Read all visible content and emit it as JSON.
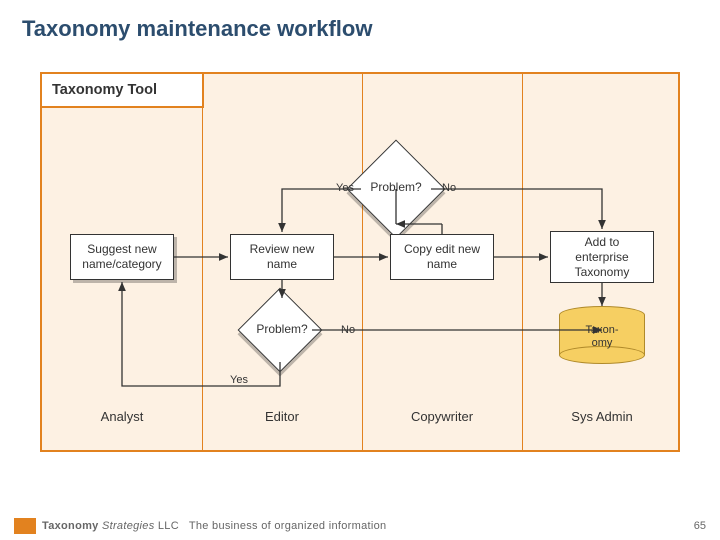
{
  "title": "Taxonomy maintenance workflow",
  "lane_title": "Taxonomy Tool",
  "nodes": {
    "suggest": "Suggest new\nname/category",
    "review": "Review new\nname",
    "copyedit": "Copy edit new\nname",
    "add": "Add to\nenterprise\nTaxonomy",
    "problem_top": "Problem?",
    "problem_left": "Problem?",
    "db": "Taxon-\nomy"
  },
  "labels": {
    "yes": "Yes",
    "no": "No"
  },
  "roles": {
    "r0": "Analyst",
    "r1": "Editor",
    "r2": "Copywriter",
    "r3": "Sys Admin"
  },
  "footer": {
    "brand_strong": "Taxonomy",
    "brand_em": "Strategies",
    "brand_suffix": "LLC",
    "tagline": "The business of organized information",
    "page": "65"
  }
}
